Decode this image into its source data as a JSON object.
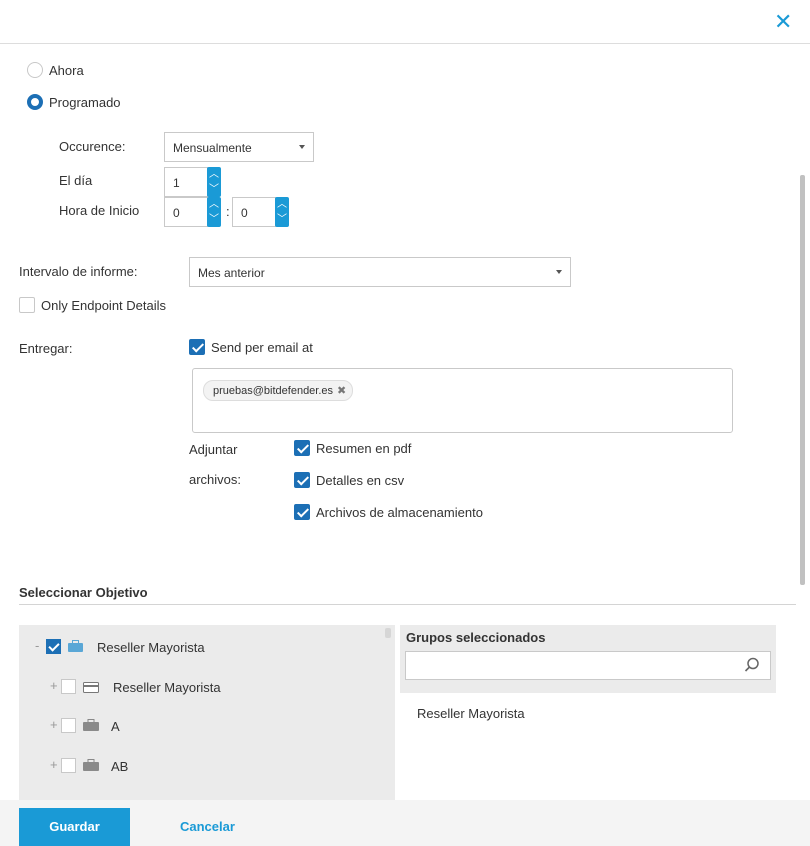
{
  "header": {
    "close_icon": "close-icon"
  },
  "schedule": {
    "option_now": "Ahora",
    "option_scheduled": "Programado",
    "selected": "Programado",
    "occurrence_label": "Occurence:",
    "occurrence_value": "Mensualmente",
    "day_label": "El día",
    "day_value": "1",
    "start_label": "Hora de Inicio",
    "start_hour": "0",
    "start_minute": "0",
    "separator": ":"
  },
  "report": {
    "interval_label": "Intervalo de informe:",
    "interval_value": "Mes anterior",
    "only_endpoint_label": "Only Endpoint Details",
    "only_endpoint_checked": false
  },
  "deliver": {
    "label": "Entregar:",
    "email_label": "Send per email at",
    "email_checked": true,
    "emails": [
      "pruebas@bitdefender.es"
    ],
    "attach_label_1": "Adjuntar",
    "attach_label_2": "archivos:",
    "attachments": [
      {
        "label": "Resumen en pdf",
        "checked": true
      },
      {
        "label": "Detalles en csv",
        "checked": true
      },
      {
        "label": "Archivos de almacenamiento",
        "checked": true
      }
    ]
  },
  "target": {
    "title": "Seleccionar Objetivo",
    "tree": [
      {
        "label": "Reseller Mayorista",
        "expander": "-",
        "checked": true,
        "icon": "briefcase-icon"
      },
      {
        "label": "Reseller Mayorista",
        "expander": "+",
        "checked": false,
        "icon": "card-icon"
      },
      {
        "label": "A",
        "expander": "+",
        "checked": false,
        "icon": "briefcase-icon"
      },
      {
        "label": "AB",
        "expander": "+",
        "checked": false,
        "icon": "briefcase-icon"
      }
    ],
    "selected_title": "Grupos seleccionados",
    "search_placeholder": "",
    "selected_items": [
      "Reseller Mayorista"
    ]
  },
  "footer": {
    "save_label": "Guardar",
    "cancel_label": "Cancelar"
  },
  "colors": {
    "accent": "#1a9ad6",
    "check": "#1c6fb5",
    "panel": "#ebebeb"
  }
}
